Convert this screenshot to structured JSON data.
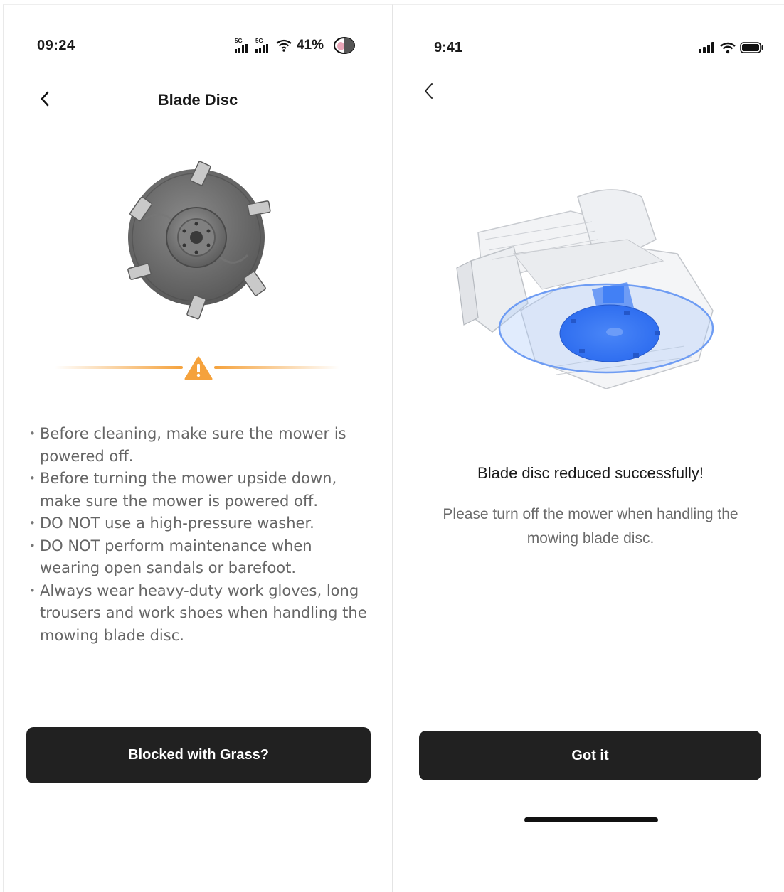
{
  "left_screen": {
    "status_bar": {
      "time": "09:24",
      "network_labels": [
        "5G",
        "5G"
      ],
      "battery": "41%"
    },
    "nav": {
      "title": "Blade Disc"
    },
    "image": "blade-disc-illustration",
    "warning_icon": "warning-triangle-icon",
    "tips": [
      "Before cleaning, make sure the mower is powered off.",
      "Before turning the mower upside down, make sure the mower is powered off.",
      "DO NOT use a high-pressure washer.",
      "DO NOT perform maintenance when wearing open sandals or barefoot.",
      "Always wear heavy-duty work gloves, long trousers and work shoes when handling the mowing blade disc."
    ],
    "button_label": "Blocked with Grass?"
  },
  "right_screen": {
    "status_bar": {
      "time": "9:41"
    },
    "image": "mower-blade-disc-illustration",
    "success_title": "Blade disc reduced successfully!",
    "success_desc": "Please turn off the mower when handling the mowing blade disc.",
    "button_label": "Got it"
  },
  "colors": {
    "button_bg": "#212121",
    "warning_orange": "#f5a23c",
    "highlight_blue": "#3d7df5",
    "disc_gray": "#6f6f6f"
  }
}
